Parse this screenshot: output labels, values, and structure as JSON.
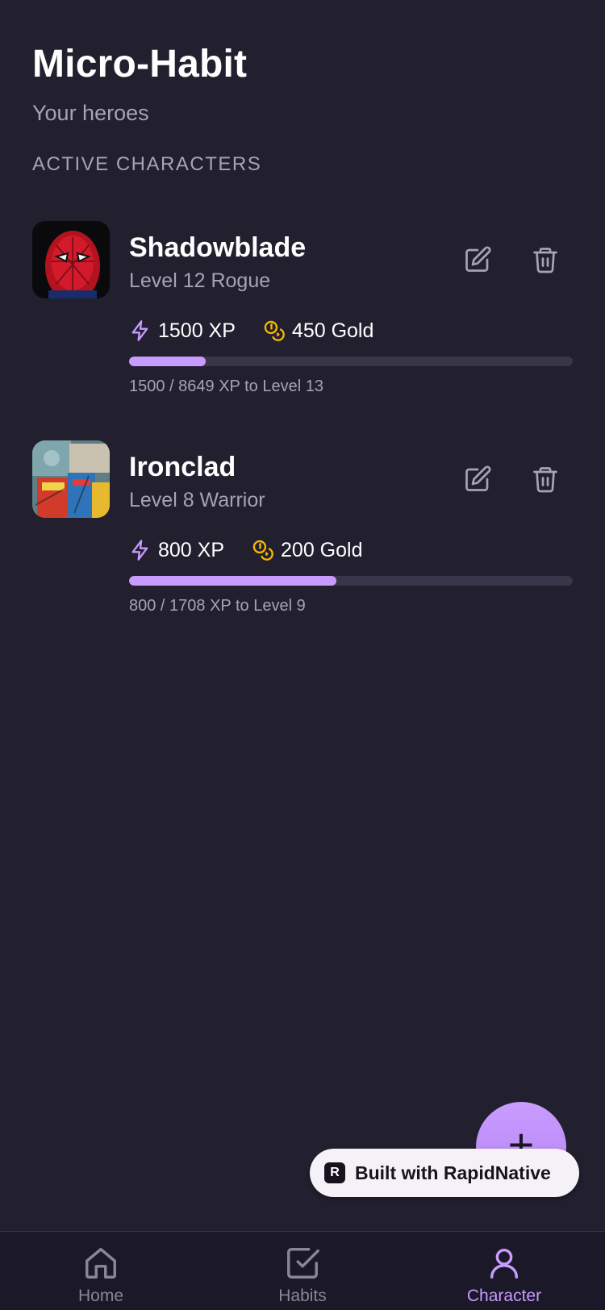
{
  "header": {
    "title": "Micro-Habit",
    "subtitle": "Your heroes"
  },
  "section_label": "ACTIVE CHARACTERS",
  "characters": [
    {
      "name": "Shadowblade",
      "class_line": "Level 12 Rogue",
      "xp": "1500 XP",
      "gold": "450 Gold",
      "progress_text": "1500 / 8649 XP to Level 13",
      "progress_fraction": 0.173
    },
    {
      "name": "Ironclad",
      "class_line": "Level 8 Warrior",
      "xp": "800 XP",
      "gold": "200 Gold",
      "progress_text": "800 / 1708 XP to Level 9",
      "progress_fraction": 0.468
    }
  ],
  "fab": {
    "icon": "plus-icon",
    "label": "+"
  },
  "badge": {
    "text": "Built with RapidNative",
    "logo": "R"
  },
  "tabs": [
    {
      "label": "Home",
      "icon": "home-icon",
      "active": false
    },
    {
      "label": "Habits",
      "icon": "check-square-icon",
      "active": false
    },
    {
      "label": "Character",
      "icon": "user-icon",
      "active": true
    }
  ],
  "colors": {
    "background": "#221f2e",
    "accent": "#c79bff",
    "gold": "#f5b800",
    "muted_text": "#a7a3b6",
    "track": "#3a3649",
    "tab_inactive": "#8a8699"
  }
}
